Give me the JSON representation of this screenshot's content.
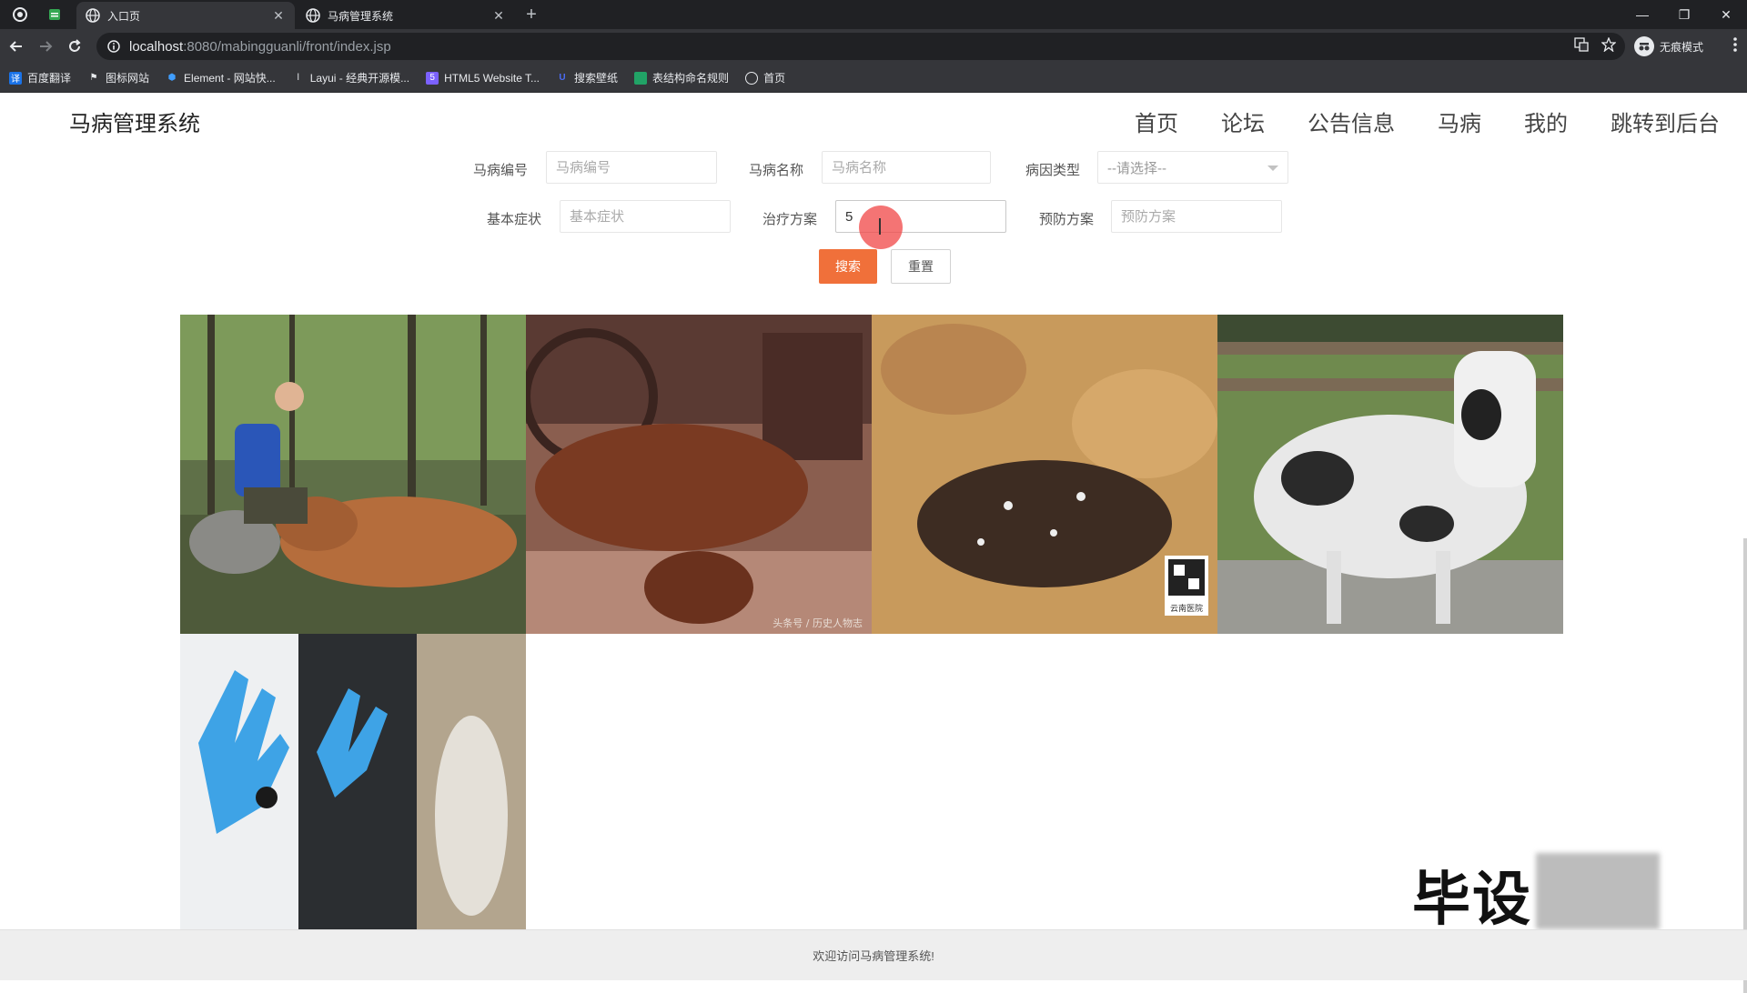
{
  "browser": {
    "tabs": [
      {
        "title": "",
        "favicon_color": "#34a853"
      },
      {
        "title": "入口页",
        "active": true
      },
      {
        "title": "马病管理系统",
        "active": false
      }
    ],
    "url_host": "localhost",
    "url_path": ":8080/mabingguanli/front/index.jsp",
    "profile_label": "无痕模式",
    "bookmarks": [
      {
        "label": "百度翻译",
        "color": "#1a73e8"
      },
      {
        "label": "图标网站",
        "color": "#e8eaed"
      },
      {
        "label": "Element - 网站快...",
        "color": "#409eff"
      },
      {
        "label": "Layui - 经典开源模...",
        "color": "#e8eaed"
      },
      {
        "label": "HTML5 Website T...",
        "color": "#7b61ff"
      },
      {
        "label": "搜索壁纸",
        "color": "#4a6cf7"
      },
      {
        "label": "表结构命名规则",
        "color": "#21a366"
      },
      {
        "label": "首页",
        "color": "#e8eaed"
      }
    ]
  },
  "site": {
    "brand": "马病管理系统",
    "nav": [
      "首页",
      "论坛",
      "公告信息",
      "马病",
      "我的",
      "跳转到后台"
    ]
  },
  "search": {
    "fields": {
      "code": {
        "label": "马病编号",
        "placeholder": "马病编号",
        "value": ""
      },
      "name": {
        "label": "马病名称",
        "placeholder": "马病名称",
        "value": ""
      },
      "type": {
        "label": "病因类型",
        "selected": "--请选择--"
      },
      "symptom": {
        "label": "基本症状",
        "placeholder": "基本症状",
        "value": ""
      },
      "treatment": {
        "label": "治疗方案",
        "placeholder": "治疗方案",
        "value": "5"
      },
      "prevention": {
        "label": "预防方案",
        "placeholder": "预防方案",
        "value": ""
      }
    },
    "search_label": "搜索",
    "reset_label": "重置"
  },
  "gallery": {
    "items": [
      {
        "caption": ""
      },
      {
        "caption": "头条号 / 历史人物志"
      },
      {
        "caption": "云南医院"
      },
      {
        "caption": ""
      },
      {
        "caption": ""
      }
    ]
  },
  "watermark": "毕设",
  "footer": "欢迎访问马病管理系统!"
}
